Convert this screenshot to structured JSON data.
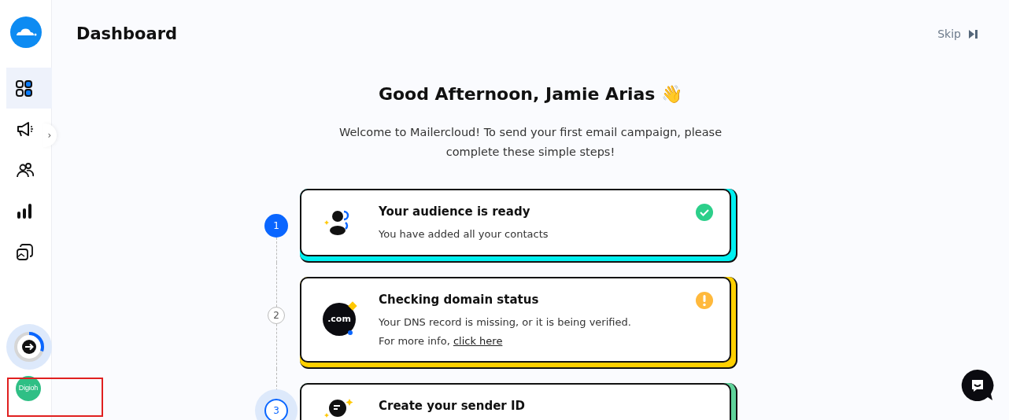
{
  "sidebar": {
    "items": [
      {
        "selected": true
      },
      {
        "selected": false
      },
      {
        "selected": false
      },
      {
        "selected": false
      },
      {
        "selected": false
      }
    ],
    "expand_toggle": "›",
    "progress": {
      "level": 0.3
    },
    "account_badge": "Digioh"
  },
  "header": {
    "title": "Dashboard",
    "skip": "Skip"
  },
  "greeting": "Good Afternoon, Jamie Arias 👋",
  "welcome": "Welcome to Mailercloud! To send your first email campaign, please complete these simple steps!",
  "steps": [
    {
      "number": "1",
      "kind": "done",
      "color": "#00f0f0",
      "title": "Your audience is ready",
      "lines": [
        "You have added all your contacts"
      ]
    },
    {
      "number": "2",
      "kind": "warning",
      "color": "#ffd000",
      "icon_text": ".com",
      "title": "Checking domain status",
      "lines": [
        "Your DNS record is missing, or it is being verified."
      ],
      "info": "For more info, ",
      "link": "click here"
    },
    {
      "number": "3",
      "kind": "current",
      "color": "#5fd39a",
      "title": "Create your sender ID"
    }
  ]
}
